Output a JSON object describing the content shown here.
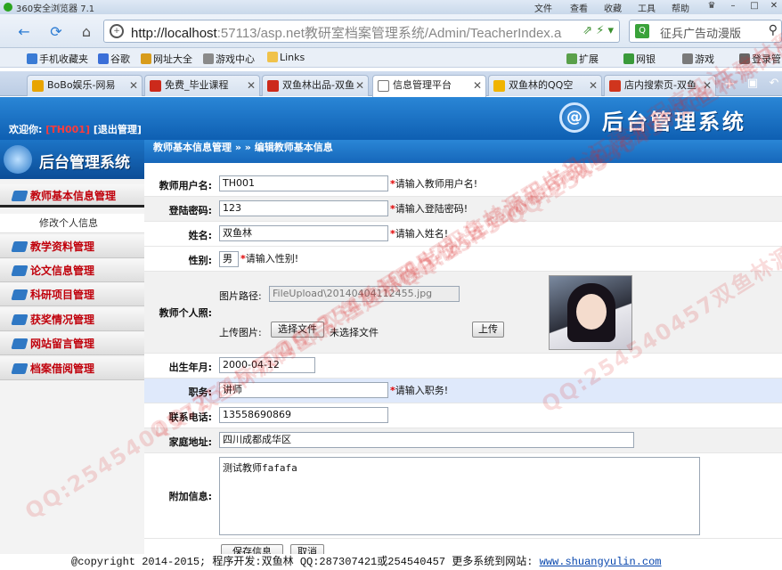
{
  "browser": {
    "app_title": "360安全浏览器 7.1",
    "menu": [
      "文件",
      "查看",
      "收藏",
      "工具",
      "帮助"
    ],
    "url_host": "http://localhost",
    "url_path": ":57113/asp.net教研室档案管理系统/Admin/TeacherIndex.a",
    "search_text": "征兵广告动漫版",
    "bookmarks": [
      "手机收藏夹",
      "谷歌",
      "网址大全",
      "游戏中心",
      "Links",
      "扩展",
      "网银",
      "游戏",
      "登录管"
    ],
    "tabs": [
      {
        "label": "BoBo娱乐-网易",
        "color": "#e8a400",
        "active": false
      },
      {
        "label": "免费_毕业课程",
        "color": "#cc2a1b",
        "active": false
      },
      {
        "label": "双鱼林出品-双鱼",
        "color": "#cc2a1b",
        "active": false
      },
      {
        "label": "信息管理平台",
        "color": "#ffffff",
        "active": true
      },
      {
        "label": "双鱼林的QQ空",
        "color": "#f0b400",
        "active": false
      },
      {
        "label": "店内搜索页-双鱼",
        "color": "#d0351d",
        "active": false
      }
    ]
  },
  "header": {
    "welcome_prefix": "欢迎你:",
    "user_id": "[TH001]",
    "logout": "[退出管理]",
    "system_title": "后台管理系统",
    "logo_symbol": "@"
  },
  "sidebar": {
    "logo_title": "后台管理系统",
    "menu": [
      {
        "label": "教师基本信息管理",
        "open": true
      },
      {
        "label": "教学资料管理"
      },
      {
        "label": "论文信息管理"
      },
      {
        "label": "科研项目管理"
      },
      {
        "label": "获奖情况管理"
      },
      {
        "label": "网站留言管理"
      },
      {
        "label": "档案借阅管理"
      }
    ],
    "sub_items": [
      "修改个人信息"
    ]
  },
  "breadcrumb": "教师基本信息管理 » » 编辑教师基本信息",
  "form": {
    "username": {
      "label": "教师用户名:",
      "value": "TH001",
      "hint": "请输入教师用户名!"
    },
    "password": {
      "label": "登陆密码:",
      "value": "123",
      "hint": "请输入登陆密码!"
    },
    "name": {
      "label": "姓名:",
      "value": "双鱼林",
      "hint": "请输入姓名!"
    },
    "gender": {
      "label": "性别:",
      "value": "男",
      "hint": "请输入性别!"
    },
    "photo": {
      "label": "教师个人照:",
      "path_label": "图片路径:",
      "path_value": "FileUpload\\20140404112455.jpg",
      "upload_label": "上传图片:",
      "choose_button": "选择文件",
      "no_file": "未选择文件",
      "upload_button": "上传"
    },
    "birthday": {
      "label": "出生年月:",
      "value": "2000-04-12"
    },
    "position": {
      "label": "职务:",
      "value": "讲师",
      "hint": "请输入职务!"
    },
    "phone": {
      "label": "联系电话:",
      "value": "13558690869"
    },
    "address": {
      "label": "家庭地址:",
      "value": "四川成都成华区"
    },
    "extra": {
      "label": "附加信息:",
      "value": "测试教师fafafa"
    },
    "save_button": "保存信息",
    "cancel_button": "取消"
  },
  "footer": {
    "text": "@copyright 2014-2015; 程序开发:双鱼林  QQ:287307421或254540457  更多系统到网站:",
    "link": "www.shuangyulin.com"
  },
  "watermark": "QQ:254540457双鱼林源码出品 汪建林程序设计",
  "colors": {
    "header_blue": "#0e5fb2",
    "menu_red": "#c0000b",
    "required_star": "#e00000"
  }
}
